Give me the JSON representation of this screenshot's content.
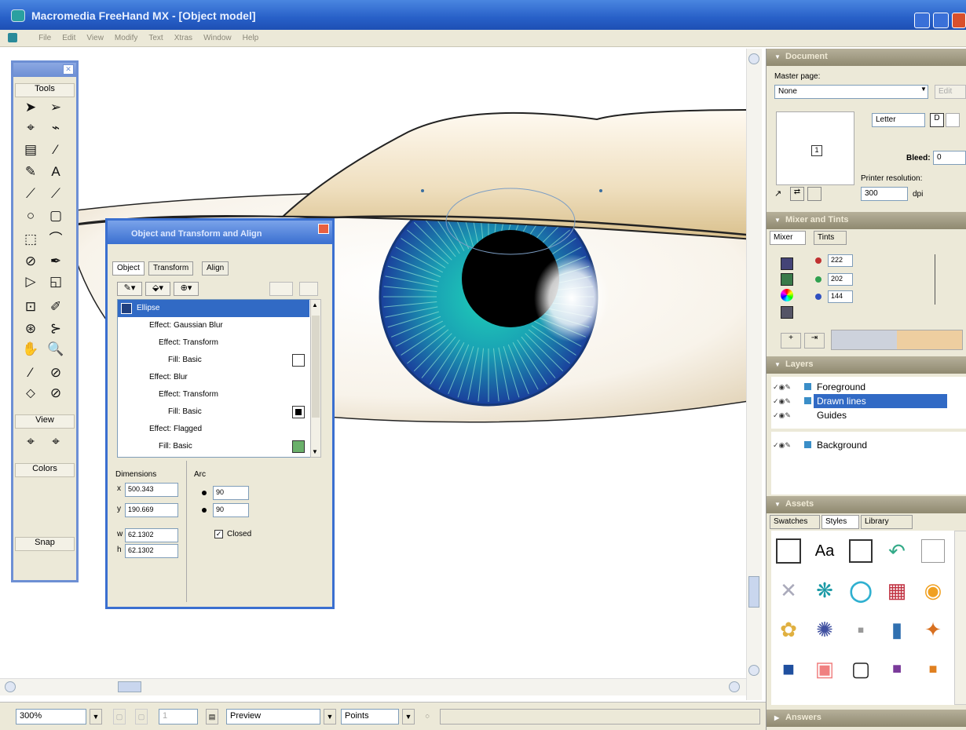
{
  "titlebar": {
    "title": "Macromedia FreeHand MX - [Object model]"
  },
  "menubar": {
    "items": [
      "File",
      "Edit",
      "View",
      "Modify",
      "Text",
      "Xtras",
      "Window",
      "Help"
    ]
  },
  "tools": {
    "header": "Tools",
    "view_label": "View",
    "colors_label": "Colors",
    "snap_label": "Snap",
    "glyphs": [
      "➤",
      "➢",
      "⌖",
      "⌁",
      "▤",
      "⁄",
      "✎",
      "A",
      "⟋",
      "⟋",
      "○",
      "▢",
      "⬚",
      "⌒",
      "⊘",
      "✒",
      "▷",
      "◱",
      "⊡",
      "✐",
      "⊛",
      "⊱",
      "✋",
      "🔍",
      "⁄",
      "⊘",
      "⬦",
      "⊘",
      "⌖",
      "⌖"
    ]
  },
  "object_panel": {
    "title": "Object and Transform and Align",
    "tabs": [
      "Object",
      "Transform",
      "Align"
    ],
    "tree": [
      {
        "label": "Ellipse",
        "indent": 0,
        "selected": true
      },
      {
        "label": "Effect: Gaussian Blur",
        "indent": 1,
        "selected": false
      },
      {
        "label": "Effect: Transform",
        "indent": 2,
        "selected": false
      },
      {
        "label": "Fill: Basic",
        "indent": 3,
        "selected": false,
        "swatch": "#ffffff"
      },
      {
        "label": "Effect: Blur",
        "indent": 1,
        "selected": false
      },
      {
        "label": "Effect: Transform",
        "indent": 2,
        "selected": false
      },
      {
        "label": "Fill: Basic",
        "indent": 3,
        "selected": false,
        "swatch": "#000000"
      },
      {
        "label": "Effect: Flagged",
        "indent": 1,
        "selected": false
      },
      {
        "label": "Fill: Basic",
        "indent": 2,
        "selected": false,
        "swatch": "#6ab06a"
      }
    ],
    "dimensions_label": "Dimensions",
    "arc_label": "Arc",
    "x_label": "x",
    "x_value": "500.343",
    "y_label": "y",
    "y_value": "190.669",
    "w_label": "w",
    "w_value": "62.1302",
    "h_label": "h",
    "h_value": "62.1302",
    "arc_start": "90",
    "arc_end": "90",
    "closed_label": "Closed"
  },
  "document_panel": {
    "title": "Document",
    "master_page_label": "Master page:",
    "master_page_value": "None",
    "edit_label": "Edit",
    "page_size": "Letter",
    "bleed_label": "Bleed:",
    "bleed_value": "0",
    "page_number": "1",
    "printer_resolution_label": "Printer resolution:",
    "resolution_value": "300",
    "dpi_label": "dpi"
  },
  "mixer_panel": {
    "title": "Mixer and Tints",
    "tabs": [
      "Mixer",
      "Tints"
    ],
    "r_value": "222",
    "g_value": "202",
    "b_value": "144",
    "mix_color": "#eeceA0"
  },
  "layers_panel": {
    "title": "Layers",
    "layers": [
      {
        "name": "Foreground",
        "selected": false,
        "color": "#3a8ec8"
      },
      {
        "name": "Drawn lines",
        "selected": true,
        "color": "#3a8ec8"
      },
      {
        "name": "Guides",
        "selected": false,
        "color": ""
      },
      {
        "name": "Background",
        "selected": false,
        "color": "#3a8ec8"
      }
    ]
  },
  "assets_panel": {
    "title": "Assets",
    "tabs": [
      "Swatches",
      "Styles",
      "Library"
    ],
    "text_style": "Aa"
  },
  "answers_panel": {
    "title": "Answers"
  },
  "statusbar": {
    "zoom": "300%",
    "page": "1",
    "view_mode": "Preview",
    "units": "Points"
  },
  "colors": {
    "selection_blue": "#316ac5",
    "iris_outer": "#1e4fa8",
    "iris_inner": "#1bb4a8",
    "eyelid": "#e8d3a8"
  }
}
